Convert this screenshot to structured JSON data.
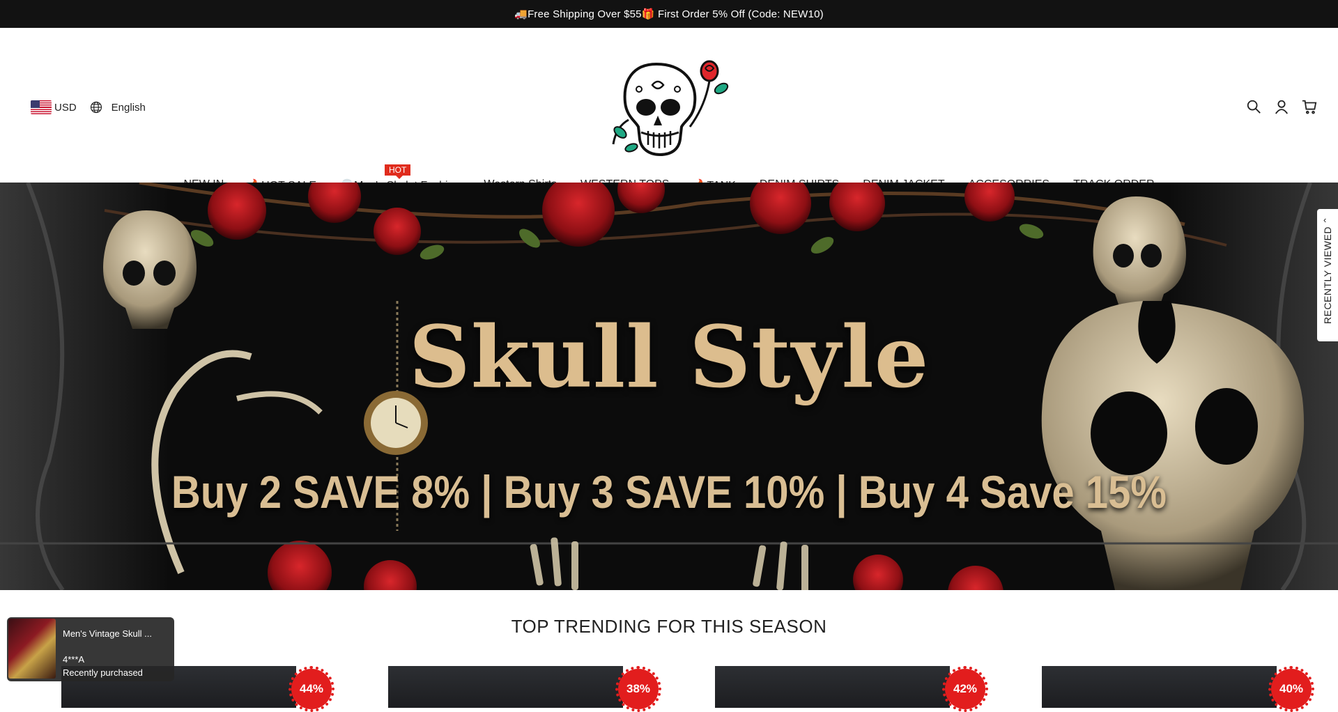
{
  "announcement": {
    "text": "🚚Free Shipping Over $55🎁 First Order 5% Off (Code: NEW10)"
  },
  "header": {
    "currency": "USD",
    "language": "English"
  },
  "nav": {
    "items": [
      "NEW IN",
      "🔥HOT SALE",
      "💀Men's Skelet Fashion",
      "Western Shirts",
      "WESTERN TOPS",
      "🔥TANK",
      "DENIM SHIRTS",
      "DENIM JACKET",
      "ACCESORRIES",
      "TRACK ORDER"
    ],
    "hot_badge": "HOT"
  },
  "hero": {
    "title": "Skull Style",
    "subtitle": "Buy 2 SAVE 8% | Buy 3 SAVE 10% | Buy 4 Save 15%"
  },
  "recently_viewed": {
    "label": "RECENTLY VIEWED"
  },
  "section": {
    "title": "TOP TRENDING FOR THIS SEASON"
  },
  "products": [
    {
      "discount": "44%"
    },
    {
      "discount": "38%"
    },
    {
      "discount": "42%"
    },
    {
      "discount": "40%"
    }
  ],
  "purchase_popup": {
    "product": "Men's Vintage Skull ...",
    "buyer": "4***A",
    "status": "Recently purchased"
  },
  "colors": {
    "announcement_bg": "#121212",
    "hot_badge": "#e02c1d",
    "discount_badge": "#e21d1d",
    "hero_text": "#dcbd8e"
  }
}
